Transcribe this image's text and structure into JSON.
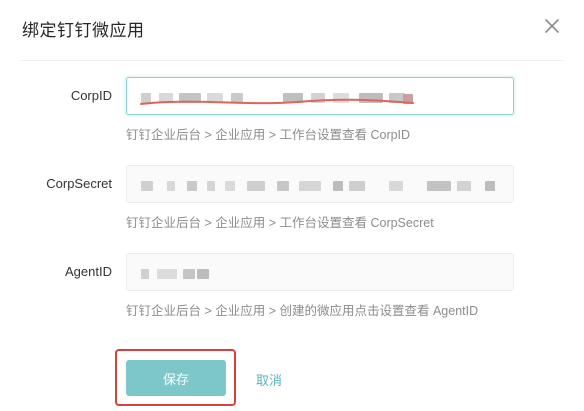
{
  "dialog": {
    "title": "绑定钉钉微应用",
    "close_icon": "close-icon"
  },
  "fields": [
    {
      "label": "CorpID",
      "value_redacted": true,
      "hint": "钉钉企业后台 > 企业应用 > 工作台设置查看 CorpID",
      "state": "focused"
    },
    {
      "label": "CorpSecret",
      "value_redacted": true,
      "hint": "钉钉企业后台 > 企业应用 > 工作台设置查看 CorpSecret",
      "state": "default"
    },
    {
      "label": "AgentID",
      "value_redacted": true,
      "hint": "钉钉企业后台 > 企业应用 > 创建的微应用点击设置查看 AgentID",
      "state": "default"
    }
  ],
  "actions": {
    "save_label": "保存",
    "cancel_label": "取消"
  },
  "colors": {
    "accent": "#7ec7c9",
    "link": "#5bb5b8",
    "highlight": "#d8403b",
    "focus_border": "#8fd0d3"
  }
}
